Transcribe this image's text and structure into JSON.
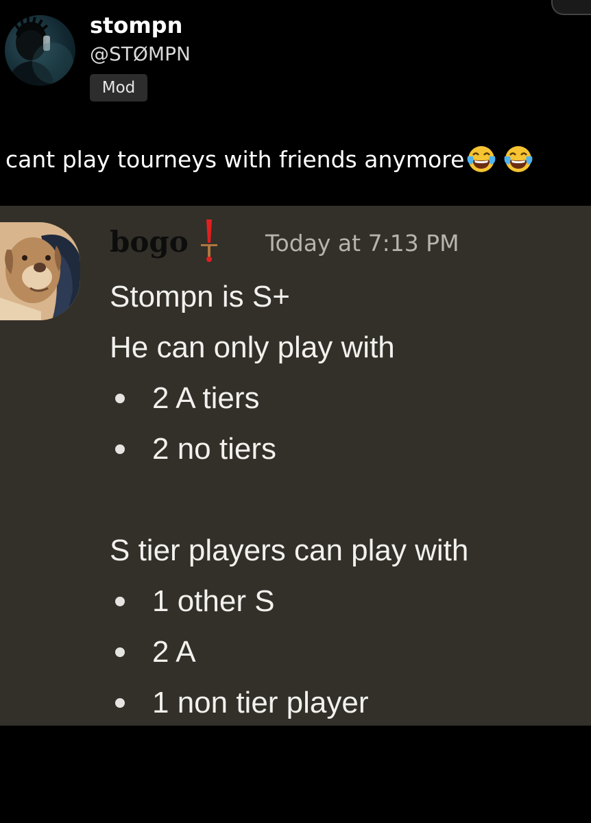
{
  "post": {
    "author_name": "stompn",
    "author_handle": "@STØMPN",
    "badge": "Mod",
    "text": "cant play tourneys with friends anymore",
    "emoji_icons": [
      "face-with-tears-of-joy-icon",
      "face-with-tears-of-joy-icon"
    ]
  },
  "message": {
    "author": "bogo",
    "role_icon": "exclamation-sword-icon",
    "timestamp": "Today at 7:13 PM",
    "line1": "Stompn is S+",
    "line2": "He can only play with",
    "list1": [
      "2 A tiers",
      "2 no tiers"
    ],
    "line3": "S tier players can play with",
    "list2": [
      "1 other S",
      "2 A",
      "1 non tier player"
    ]
  },
  "colors": {
    "background": "#000000",
    "discord_background": "#333029",
    "message_text": "#f2f1ee",
    "timestamp": "#b6b4ad",
    "role_icon": "#e02020"
  }
}
